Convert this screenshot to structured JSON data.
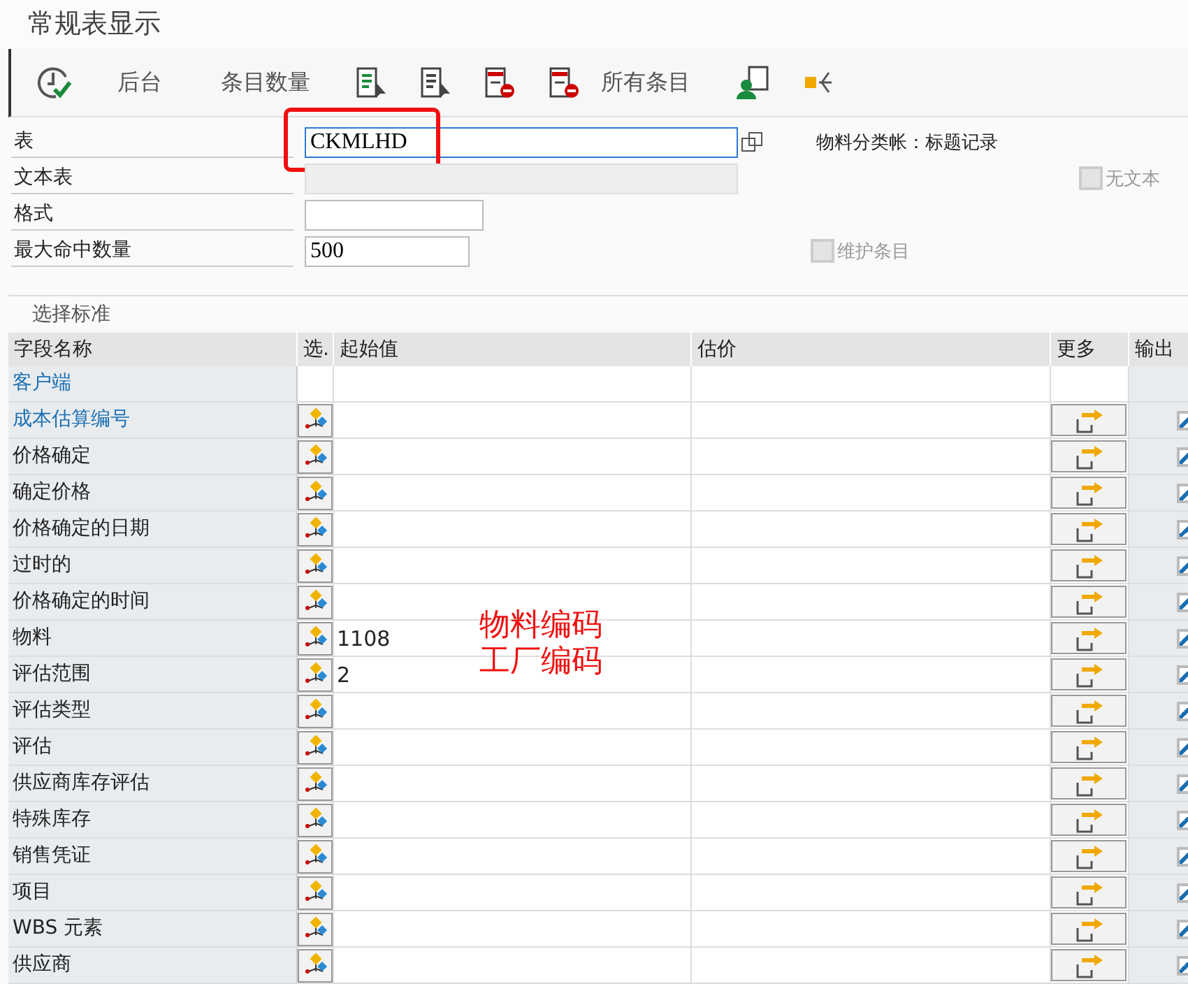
{
  "window": {
    "title": "常规表显示"
  },
  "toolbar": [
    {
      "kind": "execute"
    },
    {
      "kind": "text",
      "label": "后台"
    },
    {
      "kind": "text",
      "label": "条目数量"
    },
    {
      "kind": "select-list"
    },
    {
      "kind": "select-doc"
    },
    {
      "kind": "delete"
    },
    {
      "kind": "delete",
      "label": "所有条目"
    },
    {
      "kind": "person"
    },
    {
      "kind": "tree"
    }
  ],
  "form": {
    "table_label": "表",
    "table_value": "CKMLHD",
    "text_table_label": "文本表",
    "layout_label": "格式",
    "max_hits_label": "最大命中数量",
    "max_hits_value": "500",
    "description": "物料分类帐：标题记录",
    "no_text": {
      "label": "无文本",
      "checked": false
    },
    "maintain": {
      "label": "维护条目",
      "checked": false
    }
  },
  "selection": {
    "title": "选择标准",
    "columns": [
      "字段名称",
      "选.",
      "起始值",
      "估价",
      "更多",
      "输出"
    ],
    "rows": [
      {
        "kind": "group",
        "name": "客户端",
        "key": true
      },
      {
        "kind": "field",
        "name": "成本估算编号",
        "key": true,
        "output": true
      },
      {
        "kind": "field",
        "name": "价格确定",
        "key": false,
        "output": true
      },
      {
        "kind": "field",
        "name": "确定价格",
        "key": false,
        "output": true
      },
      {
        "kind": "field",
        "name": "价格确定的日期",
        "key": false,
        "output": true
      },
      {
        "kind": "field",
        "name": "过时的",
        "key": false,
        "output": true
      },
      {
        "kind": "field",
        "name": "价格确定的时间",
        "key": false,
        "output": true
      },
      {
        "kind": "field",
        "name": "物料",
        "key": false,
        "value": "1108",
        "output": true
      },
      {
        "kind": "field",
        "name": "评估范围",
        "key": false,
        "value": "2",
        "output": true
      },
      {
        "kind": "field",
        "name": "评估类型",
        "key": false,
        "output": true
      },
      {
        "kind": "field",
        "name": "评估",
        "key": false,
        "output": true
      },
      {
        "kind": "field",
        "name": "供应商库存评估",
        "key": false,
        "output": true
      },
      {
        "kind": "field",
        "name": "特殊库存",
        "key": false,
        "output": true
      },
      {
        "kind": "field",
        "name": "销售凭证",
        "key": false,
        "output": true
      },
      {
        "kind": "field",
        "name": "项目",
        "key": false,
        "output": true
      },
      {
        "kind": "field",
        "name": "WBS 元素",
        "key": false,
        "output": true
      },
      {
        "kind": "field",
        "name": "供应商",
        "key": false,
        "output": true
      }
    ]
  },
  "annotations": [
    "物料编码",
    "工厂编码"
  ]
}
